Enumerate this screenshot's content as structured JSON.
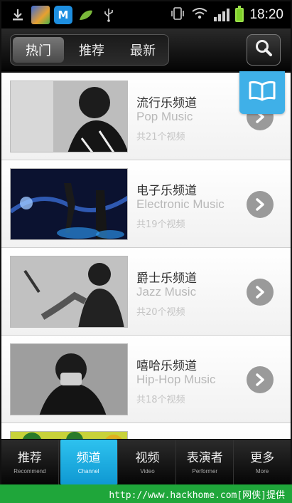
{
  "status_bar": {
    "left_icons": [
      "download-icon",
      "gallery-icon",
      "m-app-icon",
      "leaf-icon",
      "usb-icon"
    ],
    "m_app_letter": "M",
    "right_icons": [
      "vibrate-icon",
      "wifi-icon",
      "signal-icon",
      "battery-icon"
    ],
    "time": "18:20"
  },
  "header": {
    "tabs": [
      {
        "label": "热门",
        "active": true
      },
      {
        "label": "推荐",
        "active": false
      },
      {
        "label": "最新",
        "active": false
      }
    ],
    "search_icon": "search-icon"
  },
  "floating_button": {
    "icon": "book-icon"
  },
  "channels": [
    {
      "title": "流行乐频道",
      "subtitle": "Pop Music",
      "count": "共21个视频"
    },
    {
      "title": "电子乐频道",
      "subtitle": "Electronic Music",
      "count": "共19个视频"
    },
    {
      "title": "爵士乐频道",
      "subtitle": "Jazz Music",
      "count": "共20个视频"
    },
    {
      "title": "嘻哈乐频道",
      "subtitle": "Hip-Hop Music",
      "count": "共18个视频"
    }
  ],
  "bottom_nav": [
    {
      "label": "推荐",
      "sub": "Recommend",
      "active": false
    },
    {
      "label": "频道",
      "sub": "Channel",
      "active": true
    },
    {
      "label": "视频",
      "sub": "Video",
      "active": false
    },
    {
      "label": "表演者",
      "sub": "Performer",
      "active": false
    },
    {
      "label": "更多",
      "sub": "More",
      "active": false
    }
  ],
  "watermark": "http://www.hackhome.com[网侠]提供",
  "colors": {
    "accent": "#1fa0dc",
    "footer_bg": "#1fa63a",
    "arrow_bg": "#9a9a9a"
  }
}
